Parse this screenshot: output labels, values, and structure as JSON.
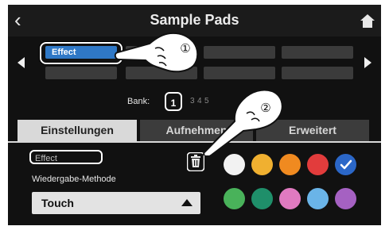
{
  "header": {
    "title": "Sample Pads"
  },
  "pads": {
    "selected_label": "Effect"
  },
  "bank": {
    "label": "Bank:",
    "current": "1",
    "others": [
      "3",
      "4",
      "5"
    ]
  },
  "tabs": [
    {
      "label": "Einstellungen",
      "active": true
    },
    {
      "label": "Aufnehmen",
      "active": false
    },
    {
      "label": "Erweitert",
      "active": false
    }
  ],
  "settings": {
    "name_value": "Effect",
    "playback_label": "Wiedergabe-Methode",
    "playback_value": "Touch"
  },
  "colors": [
    {
      "hex": "#f2f2f2",
      "selected": false
    },
    {
      "hex": "#f0b030",
      "selected": false
    },
    {
      "hex": "#f08a20",
      "selected": false
    },
    {
      "hex": "#e23c3c",
      "selected": false
    },
    {
      "hex": "#2b67c8",
      "selected": true
    },
    {
      "hex": "#49b25a",
      "selected": false
    },
    {
      "hex": "#1f8f6a",
      "selected": false
    },
    {
      "hex": "#e07ac0",
      "selected": false
    },
    {
      "hex": "#6ab4e8",
      "selected": false
    },
    {
      "hex": "#a561c2",
      "selected": false
    }
  ],
  "callouts": [
    "①",
    "②"
  ]
}
